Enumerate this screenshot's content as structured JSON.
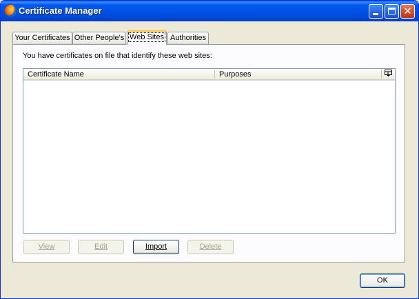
{
  "window": {
    "title": "Certificate Manager"
  },
  "tabs": [
    {
      "label": "Your Certificates"
    },
    {
      "label": "Other People's"
    },
    {
      "label": "Web Sites"
    },
    {
      "label": "Authorities"
    }
  ],
  "panel": {
    "description": "You have certificates on file that identify these web sites:",
    "columns": [
      "Certificate Name",
      "Purposes"
    ],
    "column_picker_icon": "column-picker-icon",
    "rows": []
  },
  "buttons": {
    "view": "View",
    "edit": "Edit",
    "import": "Import",
    "delete": "Delete"
  },
  "footer": {
    "ok": "OK"
  },
  "colors": {
    "titlebar": "#0058ee",
    "selected_tab_accent": "#ffc83c",
    "dialog_bg": "#ece9d8"
  }
}
